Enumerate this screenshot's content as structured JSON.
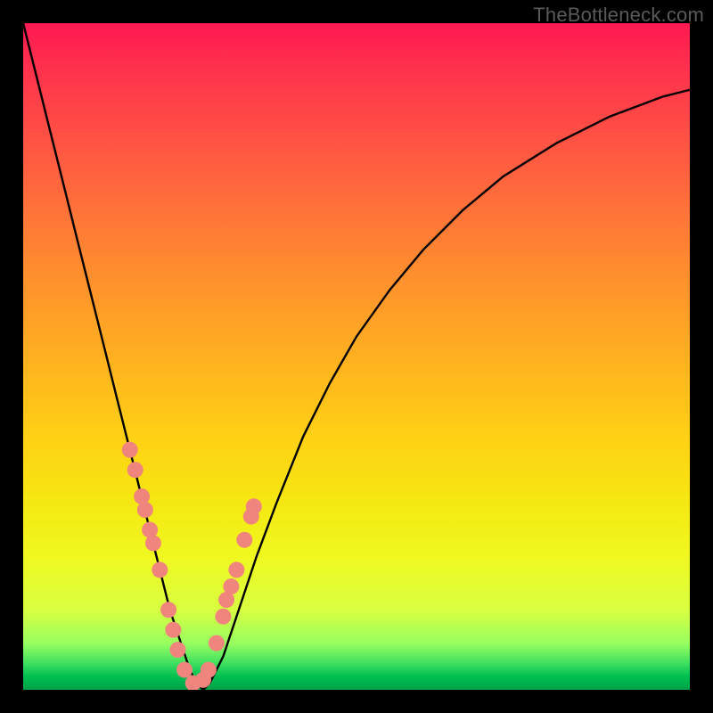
{
  "watermark": "TheBottleneck.com",
  "chart_data": {
    "type": "line",
    "title": "",
    "xlabel": "",
    "ylabel": "",
    "xlim": [
      0,
      100
    ],
    "ylim": [
      0,
      100
    ],
    "series": [
      {
        "name": "bottleneck-curve",
        "x": [
          0,
          2,
          4,
          6,
          8,
          10,
          12,
          14,
          16,
          18,
          20,
          22,
          24,
          25,
          26,
          27,
          28,
          30,
          32,
          35,
          38,
          42,
          46,
          50,
          55,
          60,
          66,
          72,
          80,
          88,
          96,
          100
        ],
        "y": [
          100,
          92,
          84,
          76,
          68,
          60,
          52,
          44,
          36,
          28,
          20,
          12,
          6,
          3,
          1,
          0,
          1,
          5,
          11,
          20,
          28,
          38,
          46,
          53,
          60,
          66,
          72,
          77,
          82,
          86,
          89,
          90
        ]
      }
    ],
    "markers": {
      "name": "highlight-dots",
      "color": "#ef857d",
      "radius": 9,
      "x": [
        16.0,
        16.8,
        17.8,
        18.3,
        19.0,
        19.5,
        20.5,
        21.8,
        22.5,
        23.2,
        24.2,
        25.5,
        27.0,
        27.8,
        29.0,
        30.0,
        30.5,
        31.2,
        32.0,
        33.2,
        34.2,
        34.6
      ],
      "y": [
        36.0,
        33.0,
        29.0,
        27.0,
        24.0,
        22.0,
        18.0,
        12.0,
        9.0,
        6.0,
        3.0,
        1.0,
        1.5,
        3.0,
        7.0,
        11.0,
        13.5,
        15.5,
        18.0,
        22.5,
        26.0,
        27.5
      ]
    },
    "background_gradient": {
      "top": "#ff1a52",
      "mid": "#ffd015",
      "bottom": "#00a048"
    }
  }
}
